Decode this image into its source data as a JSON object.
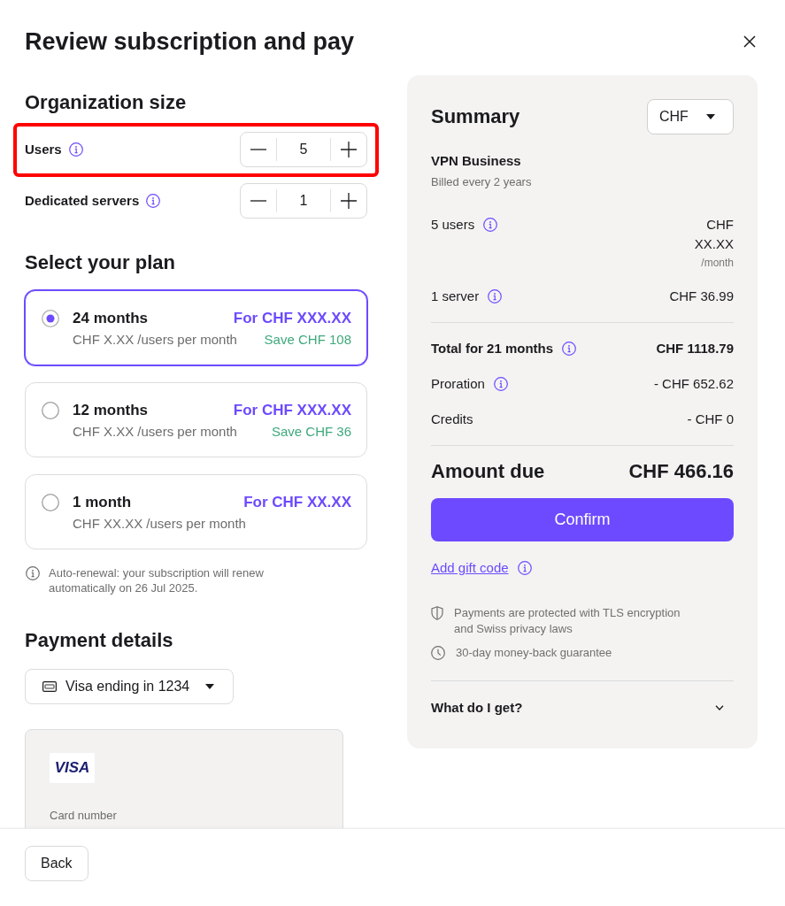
{
  "dialog": {
    "title": "Review subscription and pay"
  },
  "organization_size": {
    "heading": "Organization size",
    "rows": [
      {
        "label": "Users",
        "value": "5",
        "highlighted": true
      },
      {
        "label": "Dedicated servers",
        "value": "1",
        "highlighted": false
      }
    ]
  },
  "plan": {
    "heading": "Select your plan",
    "options": [
      {
        "label": "24 months",
        "price": "For CHF XXX.XX",
        "per_user": "CHF X.XX /users per month",
        "saving": "Save CHF 108",
        "selected": true
      },
      {
        "label": "12 months",
        "price": "For CHF XXX.XX",
        "per_user": "CHF X.XX /users per month",
        "saving": "Save CHF 36",
        "selected": false
      },
      {
        "label": "1 month",
        "price": "For CHF XX.XX",
        "per_user": "CHF XX.XX /users per month",
        "selected": false
      }
    ],
    "note": "Auto-renewal: your subscription will renew automatically on 26 Jul 2025."
  },
  "payment": {
    "heading": "Payment details",
    "method": "Visa ending in 1234",
    "card_brand": "VISA",
    "card_number_label": "Card number"
  },
  "summary": {
    "heading": "Summary",
    "currency": "CHF",
    "product": "VPN Business",
    "billing": "Billed every 2 years",
    "items": [
      {
        "label": "5 users",
        "info": true,
        "amount": "CHF XX.XX",
        "unit": "/month"
      },
      {
        "label": "1 server",
        "info": true,
        "amount": "CHF 36.99"
      }
    ],
    "totals": [
      {
        "kind": "total",
        "label": "Total for 21 months",
        "info": true,
        "amount": "CHF 1118.79"
      },
      {
        "kind": "adjustment",
        "label": "Proration",
        "info": true,
        "amount": "- CHF 652.62"
      },
      {
        "kind": "adjustment",
        "label": "Credits",
        "info": false,
        "amount": "- CHF 0"
      }
    ],
    "amount_due": {
      "label": "Amount due",
      "value": "CHF 466.16"
    },
    "confirm": "Confirm",
    "gift_code": "Add gift code",
    "assurances": [
      {
        "kind": "security",
        "text": "Payments are protected with TLS encryption and Swiss privacy laws"
      },
      {
        "kind": "refund",
        "text": "30-day money-back guarantee"
      }
    ],
    "faq": {
      "label": "What do I get?",
      "expanded": false
    }
  },
  "footer": {
    "back": "Back"
  }
}
